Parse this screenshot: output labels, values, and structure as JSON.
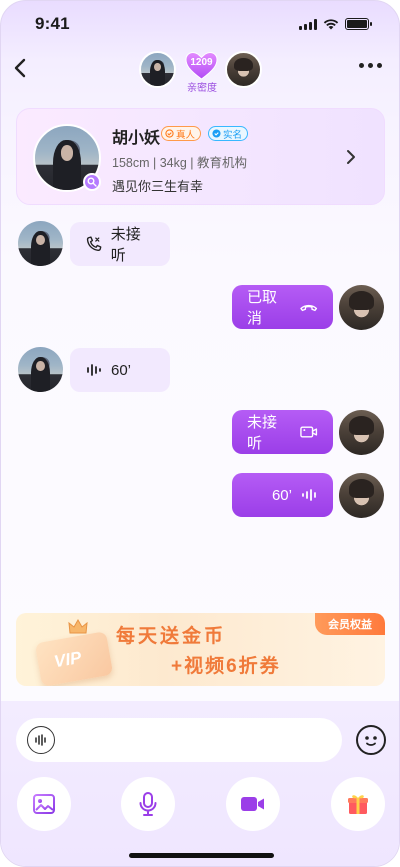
{
  "status": {
    "time": "9:41"
  },
  "header": {
    "intimacy_value": "1209",
    "intimacy_label": "亲密度",
    "back_icon": "chevron-left-icon",
    "more_icon": "more-dots-icon"
  },
  "profile": {
    "name": "胡小妖",
    "tag_real": "真人",
    "tag_verified": "实名",
    "meta": "158cm | 34kg | 教育机构",
    "motto": "遇见你三生有幸"
  },
  "messages": [
    {
      "side": "left",
      "type": "voice-call",
      "text": "未接听",
      "icon": "phone-missed-icon"
    },
    {
      "side": "right",
      "type": "voice-call",
      "text": "已取消",
      "icon": "phone-hangup-icon"
    },
    {
      "side": "left",
      "type": "voice",
      "text": "60’",
      "icon": "voice-wave-icon"
    },
    {
      "side": "right",
      "type": "video-call",
      "text": "未接听",
      "icon": "video-call-icon"
    },
    {
      "side": "right",
      "type": "voice",
      "text": "60’",
      "icon": "voice-wave-icon"
    }
  ],
  "vip_banner": {
    "ribbon": "会员权益",
    "badge": "VIP",
    "line1": "每天送金币",
    "line2": "+视频6折券"
  },
  "input": {
    "placeholder": ""
  },
  "toolbar": [
    "image-icon",
    "microphone-icon",
    "video-camera-icon",
    "gift-icon"
  ],
  "colors": {
    "accent": "#9b3ee8",
    "bubble_left": "#f2e9fe",
    "vip_text": "#f07a3a"
  }
}
